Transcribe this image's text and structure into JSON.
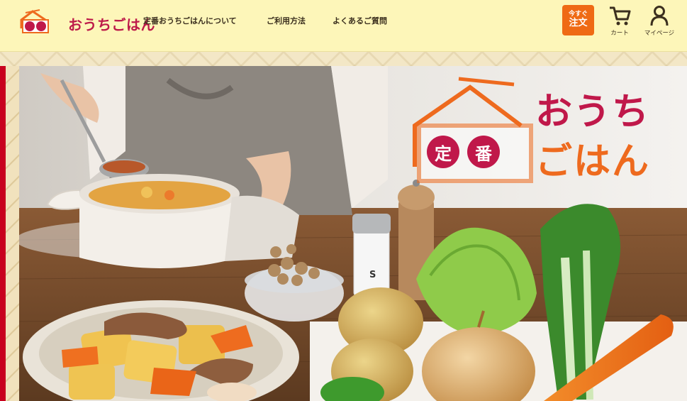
{
  "header": {
    "logo_text": "おうちごはん",
    "logo_mark_text": "定番",
    "nav": [
      {
        "label": "定番おうちごはんについて"
      },
      {
        "label": "ご利用方法"
      },
      {
        "label": "よくあるご質問"
      }
    ],
    "order_button": {
      "line1": "今すぐ",
      "line2": "注文"
    },
    "cart_label": "カート",
    "mypage_label": "マイページ"
  },
  "hero": {
    "badge_1": "定",
    "badge_2": "番",
    "title_line1": "おうち",
    "title_line2": "ごはん",
    "shaker_label": "S"
  },
  "colors": {
    "header_bg": "#fdf6b9",
    "brand_red": "#c0184a",
    "brand_orange": "#ee6a1e",
    "order_button": "#ef6a14"
  }
}
